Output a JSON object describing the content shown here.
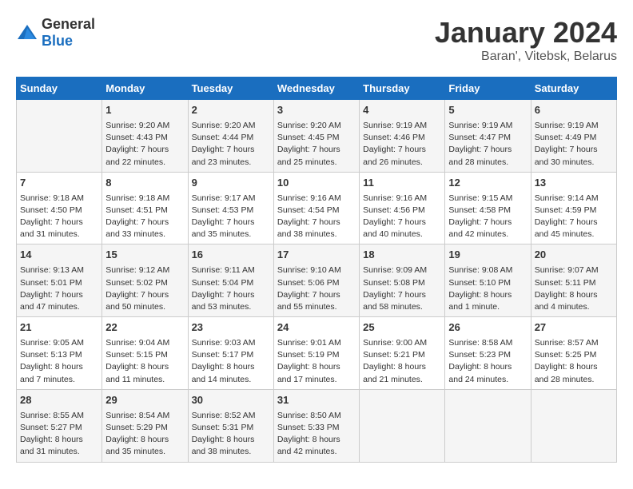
{
  "header": {
    "logo_general": "General",
    "logo_blue": "Blue",
    "title": "January 2024",
    "subtitle": "Baran', Vitebsk, Belarus"
  },
  "days_of_week": [
    "Sunday",
    "Monday",
    "Tuesday",
    "Wednesday",
    "Thursday",
    "Friday",
    "Saturday"
  ],
  "weeks": [
    [
      {
        "day": "",
        "content": ""
      },
      {
        "day": "1",
        "content": "Sunrise: 9:20 AM\nSunset: 4:43 PM\nDaylight: 7 hours\nand 22 minutes."
      },
      {
        "day": "2",
        "content": "Sunrise: 9:20 AM\nSunset: 4:44 PM\nDaylight: 7 hours\nand 23 minutes."
      },
      {
        "day": "3",
        "content": "Sunrise: 9:20 AM\nSunset: 4:45 PM\nDaylight: 7 hours\nand 25 minutes."
      },
      {
        "day": "4",
        "content": "Sunrise: 9:19 AM\nSunset: 4:46 PM\nDaylight: 7 hours\nand 26 minutes."
      },
      {
        "day": "5",
        "content": "Sunrise: 9:19 AM\nSunset: 4:47 PM\nDaylight: 7 hours\nand 28 minutes."
      },
      {
        "day": "6",
        "content": "Sunrise: 9:19 AM\nSunset: 4:49 PM\nDaylight: 7 hours\nand 30 minutes."
      }
    ],
    [
      {
        "day": "7",
        "content": "Sunrise: 9:18 AM\nSunset: 4:50 PM\nDaylight: 7 hours\nand 31 minutes."
      },
      {
        "day": "8",
        "content": "Sunrise: 9:18 AM\nSunset: 4:51 PM\nDaylight: 7 hours\nand 33 minutes."
      },
      {
        "day": "9",
        "content": "Sunrise: 9:17 AM\nSunset: 4:53 PM\nDaylight: 7 hours\nand 35 minutes."
      },
      {
        "day": "10",
        "content": "Sunrise: 9:16 AM\nSunset: 4:54 PM\nDaylight: 7 hours\nand 38 minutes."
      },
      {
        "day": "11",
        "content": "Sunrise: 9:16 AM\nSunset: 4:56 PM\nDaylight: 7 hours\nand 40 minutes."
      },
      {
        "day": "12",
        "content": "Sunrise: 9:15 AM\nSunset: 4:58 PM\nDaylight: 7 hours\nand 42 minutes."
      },
      {
        "day": "13",
        "content": "Sunrise: 9:14 AM\nSunset: 4:59 PM\nDaylight: 7 hours\nand 45 minutes."
      }
    ],
    [
      {
        "day": "14",
        "content": "Sunrise: 9:13 AM\nSunset: 5:01 PM\nDaylight: 7 hours\nand 47 minutes."
      },
      {
        "day": "15",
        "content": "Sunrise: 9:12 AM\nSunset: 5:02 PM\nDaylight: 7 hours\nand 50 minutes."
      },
      {
        "day": "16",
        "content": "Sunrise: 9:11 AM\nSunset: 5:04 PM\nDaylight: 7 hours\nand 53 minutes."
      },
      {
        "day": "17",
        "content": "Sunrise: 9:10 AM\nSunset: 5:06 PM\nDaylight: 7 hours\nand 55 minutes."
      },
      {
        "day": "18",
        "content": "Sunrise: 9:09 AM\nSunset: 5:08 PM\nDaylight: 7 hours\nand 58 minutes."
      },
      {
        "day": "19",
        "content": "Sunrise: 9:08 AM\nSunset: 5:10 PM\nDaylight: 8 hours\nand 1 minute."
      },
      {
        "day": "20",
        "content": "Sunrise: 9:07 AM\nSunset: 5:11 PM\nDaylight: 8 hours\nand 4 minutes."
      }
    ],
    [
      {
        "day": "21",
        "content": "Sunrise: 9:05 AM\nSunset: 5:13 PM\nDaylight: 8 hours\nand 7 minutes."
      },
      {
        "day": "22",
        "content": "Sunrise: 9:04 AM\nSunset: 5:15 PM\nDaylight: 8 hours\nand 11 minutes."
      },
      {
        "day": "23",
        "content": "Sunrise: 9:03 AM\nSunset: 5:17 PM\nDaylight: 8 hours\nand 14 minutes."
      },
      {
        "day": "24",
        "content": "Sunrise: 9:01 AM\nSunset: 5:19 PM\nDaylight: 8 hours\nand 17 minutes."
      },
      {
        "day": "25",
        "content": "Sunrise: 9:00 AM\nSunset: 5:21 PM\nDaylight: 8 hours\nand 21 minutes."
      },
      {
        "day": "26",
        "content": "Sunrise: 8:58 AM\nSunset: 5:23 PM\nDaylight: 8 hours\nand 24 minutes."
      },
      {
        "day": "27",
        "content": "Sunrise: 8:57 AM\nSunset: 5:25 PM\nDaylight: 8 hours\nand 28 minutes."
      }
    ],
    [
      {
        "day": "28",
        "content": "Sunrise: 8:55 AM\nSunset: 5:27 PM\nDaylight: 8 hours\nand 31 minutes."
      },
      {
        "day": "29",
        "content": "Sunrise: 8:54 AM\nSunset: 5:29 PM\nDaylight: 8 hours\nand 35 minutes."
      },
      {
        "day": "30",
        "content": "Sunrise: 8:52 AM\nSunset: 5:31 PM\nDaylight: 8 hours\nand 38 minutes."
      },
      {
        "day": "31",
        "content": "Sunrise: 8:50 AM\nSunset: 5:33 PM\nDaylight: 8 hours\nand 42 minutes."
      },
      {
        "day": "",
        "content": ""
      },
      {
        "day": "",
        "content": ""
      },
      {
        "day": "",
        "content": ""
      }
    ]
  ]
}
